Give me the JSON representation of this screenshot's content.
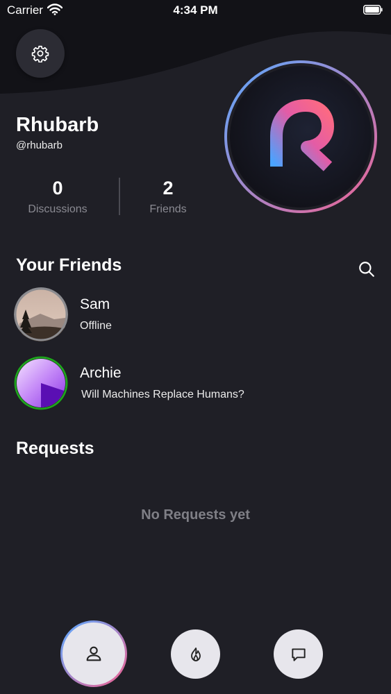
{
  "status_bar": {
    "carrier": "Carrier",
    "time": "4:34 PM"
  },
  "profile": {
    "name": "Rhubarb",
    "handle": "@rhubarb",
    "stats": [
      {
        "value": "0",
        "label": "Discussions"
      },
      {
        "value": "2",
        "label": "Friends"
      }
    ]
  },
  "friends_section": {
    "title": "Your Friends",
    "items": [
      {
        "name": "Sam",
        "status": "Offline",
        "online": false
      },
      {
        "name": "Archie",
        "status": "Will Machines Replace Humans?",
        "online": true
      }
    ]
  },
  "requests_section": {
    "title": "Requests",
    "empty_text": "No Requests yet"
  },
  "icons": {
    "settings": "gear-icon",
    "search": "search-icon",
    "tabs": [
      "profile-icon",
      "flame-icon",
      "chat-bubble-icon"
    ]
  },
  "colors": {
    "background": "#1f1f26",
    "header": "#121217",
    "accent_blue": "#5aa9ff",
    "accent_pink": "#f06292",
    "online_green": "#1fa31f"
  }
}
